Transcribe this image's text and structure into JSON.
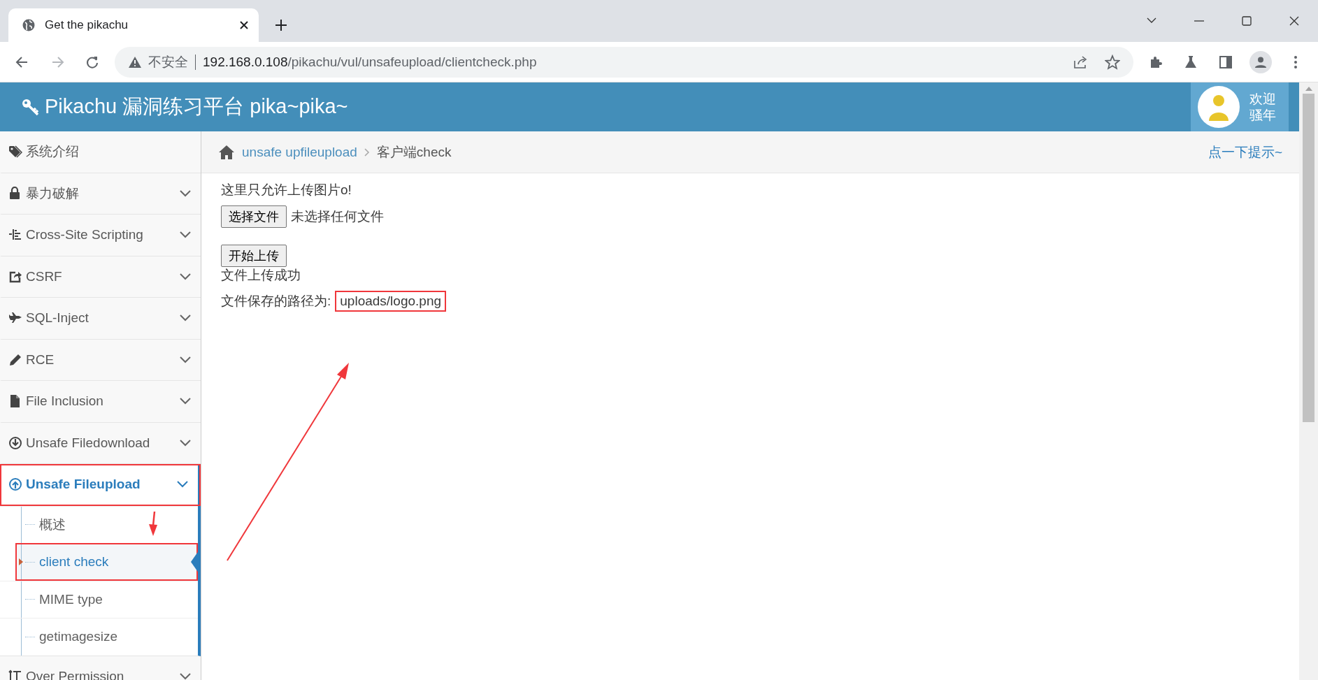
{
  "browser": {
    "tab_title": "Get the pikachu",
    "security_label": "不安全",
    "url_host": "192.168.0.108",
    "url_path": "/pikachu/vul/unsafeupload/clientcheck.php"
  },
  "header": {
    "title": "Pikachu 漏洞练习平台 pika~pika~",
    "welcome": [
      "欢迎",
      "骚年"
    ]
  },
  "sidebar": {
    "items": [
      {
        "label": "系统介绍",
        "kind": "link",
        "selected": false,
        "highlighted": false
      },
      {
        "label": "暴力破解",
        "kind": "menu",
        "selected": false,
        "highlighted": false
      },
      {
        "label": "Cross-Site Scripting",
        "kind": "menu",
        "selected": false,
        "highlighted": false
      },
      {
        "label": "CSRF",
        "kind": "menu",
        "selected": false,
        "highlighted": false
      },
      {
        "label": "SQL-Inject",
        "kind": "menu",
        "selected": false,
        "highlighted": false
      },
      {
        "label": "RCE",
        "kind": "menu",
        "selected": false,
        "highlighted": false
      },
      {
        "label": "File Inclusion",
        "kind": "menu",
        "selected": false,
        "highlighted": false
      },
      {
        "label": "Unsafe Filedownload",
        "kind": "menu",
        "selected": false,
        "highlighted": false
      },
      {
        "label": "Unsafe Fileupload",
        "kind": "menu",
        "selected": true,
        "highlighted": true,
        "children": [
          {
            "label": "概述",
            "selected": false,
            "highlighted": false
          },
          {
            "label": "client check",
            "selected": true,
            "highlighted": true
          },
          {
            "label": "MIME type",
            "selected": false,
            "highlighted": false
          },
          {
            "label": "getimagesize",
            "selected": false,
            "highlighted": false
          }
        ]
      },
      {
        "label": "Over Permission",
        "kind": "menu",
        "selected": false,
        "highlighted": false
      }
    ]
  },
  "breadcrumb": {
    "items": [
      "unsafe upfileupload",
      "客户端check"
    ],
    "hint": "点一下提示~"
  },
  "content": {
    "notice": "这里只允许上传图片o!",
    "file_button": "选择文件",
    "file_status": "未选择任何文件",
    "upload_button": "开始上传",
    "result": "文件上传成功",
    "path_label": "文件保存的路径为:",
    "path_value": "uploads/logo.png",
    "path_highlighted": true
  }
}
